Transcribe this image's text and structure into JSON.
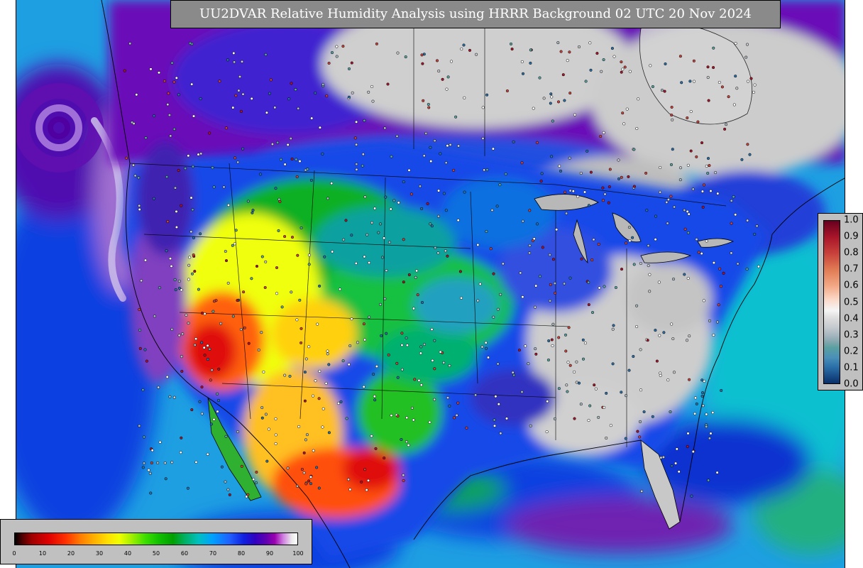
{
  "title": "UU2DVAR Relative Humidity Analysis using HRRR Background 02 UTC 20 Nov 2024",
  "colorbar_bottom": {
    "ticks": [
      "0",
      "10",
      "20",
      "30",
      "40",
      "50",
      "60",
      "70",
      "80",
      "90",
      "100"
    ],
    "range": [
      0,
      100
    ]
  },
  "colorbar_right": {
    "ticks": [
      "1.0",
      "0.9",
      "0.8",
      "0.7",
      "0.6",
      "0.5",
      "0.4",
      "0.3",
      "0.2",
      "0.1",
      "0.0"
    ],
    "range": [
      0,
      1
    ]
  },
  "colors": {
    "title_bg": "#8a8a8a",
    "title_text": "#ffffff",
    "panel_bg": "#c0c0c0",
    "ocean": "#1fa0e0",
    "dry": "#e00000",
    "moist": "#00a000",
    "humid": "#6000b0",
    "saturated": "#c8c8c8"
  }
}
